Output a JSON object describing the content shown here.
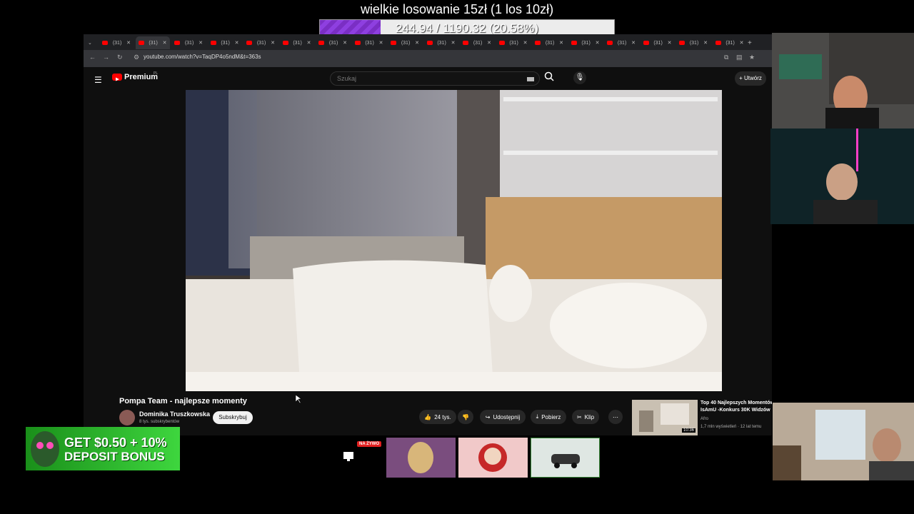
{
  "overlay": {
    "title": "wielkie losowanie 15zł (1 los 10zł)",
    "progress_text": "244.94 / 1190.32 (20.58%)",
    "progress_fraction": 0.2058
  },
  "browser": {
    "tab_label": "(31)",
    "tab_count": 18,
    "url": "youtube.com/watch?v=TaqDP4o5ndM&t=363s"
  },
  "youtube": {
    "logo": "Premium",
    "logo_sup": "PL",
    "search_placeholder": "Szukaj",
    "create_label": "Utwórz",
    "video": {
      "title": "Pompa Team - najlepsze momenty",
      "channel": "Dominika Truszkowska",
      "subs": "8 tys. subskrybentów",
      "subscribe": "Subskrybuj",
      "likes": "24 tys.",
      "share": "Udostępnij",
      "download": "Pobierz",
      "clip": "Klip"
    },
    "recommended": {
      "title_line1": "Top 40 Najlepszych Momentów",
      "title_line2": "IsAmU -Konkurs 30K Widzów",
      "channel": "Afro",
      "meta": "1,7 mln wyświetleń · 12 lat temu",
      "duration": "10:36"
    }
  },
  "ad": {
    "line1": "GET $0.50 + 10%",
    "line2": "DEPOSIT BONUS"
  },
  "bottom_bar": {
    "live_badge": "NA ŻYWO"
  },
  "colors": {
    "progress_fill": "#8e3fe0",
    "yt_red": "#ff0000",
    "ad_green": "#3ed63e"
  }
}
